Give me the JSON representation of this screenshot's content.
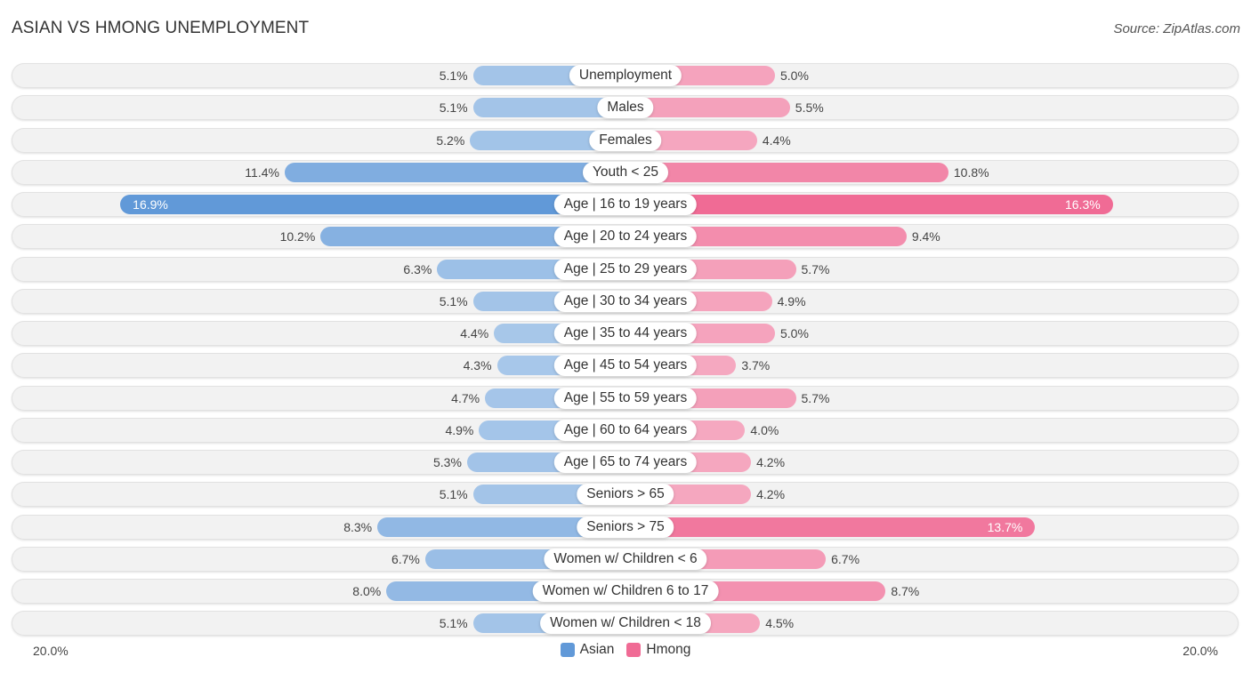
{
  "header": {
    "title": "ASIAN VS HMONG UNEMPLOYMENT",
    "source": "Source: ZipAtlas.com"
  },
  "colors": {
    "asian_light": "#a9c8ea",
    "asian_dark": "#6199d8",
    "hmong_light": "#f5a8c0",
    "hmong_dark": "#f06b95"
  },
  "chart_data": {
    "type": "bar",
    "orientation": "horizontal-diverging",
    "title": "ASIAN VS HMONG UNEMPLOYMENT",
    "categories": [
      "Unemployment",
      "Males",
      "Females",
      "Youth < 25",
      "Age | 16 to 19 years",
      "Age | 20 to 24 years",
      "Age | 25 to 29 years",
      "Age | 30 to 34 years",
      "Age | 35 to 44 years",
      "Age | 45 to 54 years",
      "Age | 55 to 59 years",
      "Age | 60 to 64 years",
      "Age | 65 to 74 years",
      "Seniors > 65",
      "Seniors > 75",
      "Women w/ Children < 6",
      "Women w/ Children 6 to 17",
      "Women w/ Children < 18"
    ],
    "series": [
      {
        "name": "Asian",
        "side": "left",
        "values": [
          5.1,
          5.1,
          5.2,
          11.4,
          16.9,
          10.2,
          6.3,
          5.1,
          4.4,
          4.3,
          4.7,
          4.9,
          5.3,
          5.1,
          8.3,
          6.7,
          8.0,
          5.1
        ],
        "labels": [
          "5.1%",
          "5.1%",
          "5.2%",
          "11.4%",
          "16.9%",
          "10.2%",
          "6.3%",
          "5.1%",
          "4.4%",
          "4.3%",
          "4.7%",
          "4.9%",
          "5.3%",
          "5.1%",
          "8.3%",
          "6.7%",
          "8.0%",
          "5.1%"
        ]
      },
      {
        "name": "Hmong",
        "side": "right",
        "values": [
          5.0,
          5.5,
          4.4,
          10.8,
          16.3,
          9.4,
          5.7,
          4.9,
          5.0,
          3.7,
          5.7,
          4.0,
          4.2,
          4.2,
          13.7,
          6.7,
          8.7,
          4.5
        ],
        "labels": [
          "5.0%",
          "5.5%",
          "4.4%",
          "10.8%",
          "16.3%",
          "9.4%",
          "5.7%",
          "4.9%",
          "5.0%",
          "3.7%",
          "5.7%",
          "4.0%",
          "4.2%",
          "4.2%",
          "13.7%",
          "6.7%",
          "8.7%",
          "4.5%"
        ]
      }
    ],
    "xlim": [
      -20,
      20
    ],
    "axis_labels": {
      "left": "20.0%",
      "right": "20.0%"
    },
    "unit": "%",
    "legend": {
      "position": "bottom-center",
      "entries": [
        "Asian",
        "Hmong"
      ]
    },
    "grid": false
  }
}
